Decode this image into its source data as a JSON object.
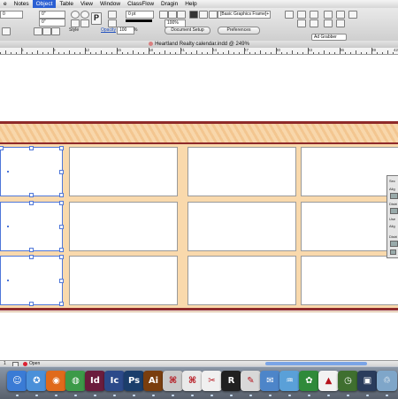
{
  "menubar": {
    "items": [
      "e",
      "Notes",
      "Object",
      "Table",
      "View",
      "Window",
      "ClassFlow",
      "Dragin",
      "Help"
    ],
    "active_index": 2
  },
  "control": {
    "field_a": "0",
    "field_b": "0\"",
    "field_c": "0\"",
    "style_label": "Style",
    "opacity_label": "Opacity",
    "opacity_value": "100",
    "percent_sign": "%",
    "stroke_value": "0 pt",
    "zoom_value": "100%",
    "frame_style": "[Basic Graphics Frame]+",
    "document_setup": "Document Setup",
    "preferences": "Preferences",
    "ad_grabber": "Ad Grabber"
  },
  "document": {
    "title": "Heartland Realty calendar.indd @ 249%"
  },
  "ruler": {
    "labels": [
      "6",
      "9",
      "12",
      "15",
      "18",
      "21",
      "24",
      "27",
      "30",
      "33",
      "36",
      "39",
      "42"
    ]
  },
  "align_panel": {
    "labels": [
      "Sec",
      "Alig",
      "Distri",
      "Use",
      "Alig",
      "Distri"
    ]
  },
  "status": {
    "page": "1",
    "open_label": "Open"
  },
  "dock": {
    "apps": [
      {
        "name": "finder",
        "glyph": "☺",
        "color": "#3a7bd5"
      },
      {
        "name": "safari",
        "glyph": "✪",
        "color": "#4a90d9"
      },
      {
        "name": "firefox",
        "glyph": "◉",
        "color": "#e06a1b"
      },
      {
        "name": "chrome",
        "glyph": "◍",
        "color": "#3c9a48"
      },
      {
        "name": "indesign",
        "glyph": "Id",
        "color": "#6b1d3d"
      },
      {
        "name": "incopy",
        "glyph": "Ic",
        "color": "#2c4a8a"
      },
      {
        "name": "photoshop",
        "glyph": "Ps",
        "color": "#1b3e6b"
      },
      {
        "name": "illustrator",
        "glyph": "Ai",
        "color": "#7a3e0e"
      },
      {
        "name": "acrobat-pro",
        "glyph": "⌘",
        "color": "#c9c9c9"
      },
      {
        "name": "acrobat",
        "glyph": "⌘",
        "color": "#e9e9e9"
      },
      {
        "name": "pdf-tool",
        "glyph": "✂",
        "color": "#f0f0f0"
      },
      {
        "name": "r-app",
        "glyph": "R",
        "color": "#202020"
      },
      {
        "name": "preview",
        "glyph": "✎",
        "color": "#d8d8d8"
      },
      {
        "name": "mail",
        "glyph": "✉",
        "color": "#4d85c9"
      },
      {
        "name": "ftp",
        "glyph": "♒",
        "color": "#5aa0d8"
      },
      {
        "name": "network",
        "glyph": "✿",
        "color": "#2f8a3a"
      },
      {
        "name": "vlc",
        "glyph": "▲",
        "color": "#f2f2f2"
      },
      {
        "name": "time-machine",
        "glyph": "◷",
        "color": "#3f6f2f"
      },
      {
        "name": "monitor",
        "glyph": "▣",
        "color": "#2a3c5c"
      },
      {
        "name": "trash",
        "glyph": "♲",
        "color": "#7fa6c9"
      }
    ]
  }
}
